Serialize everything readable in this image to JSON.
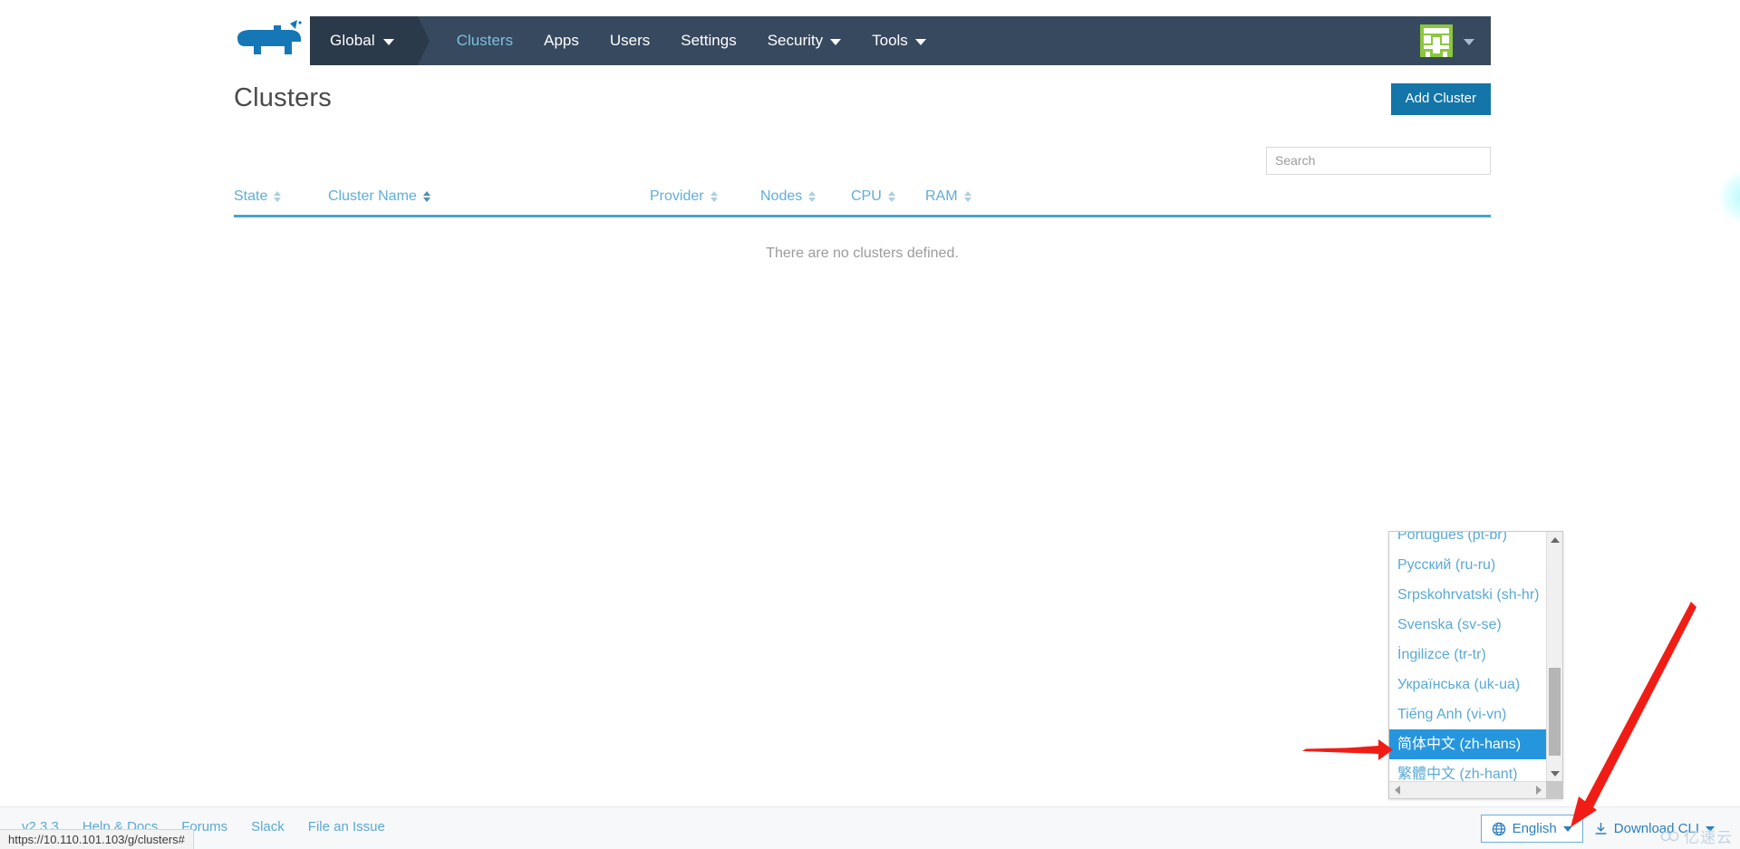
{
  "browser": {
    "status_url": "https://10.110.101.103/g/clusters#"
  },
  "header": {
    "logo_name": "rancher-cow-logo",
    "scope_selector": {
      "label": "Global"
    },
    "nav": [
      {
        "label": "Clusters",
        "active": true,
        "has_caret": false
      },
      {
        "label": "Apps",
        "active": false,
        "has_caret": false
      },
      {
        "label": "Users",
        "active": false,
        "has_caret": false
      },
      {
        "label": "Settings",
        "active": false,
        "has_caret": false
      },
      {
        "label": "Security",
        "active": false,
        "has_caret": true
      },
      {
        "label": "Tools",
        "active": false,
        "has_caret": true
      }
    ],
    "avatar_alt": "user-avatar"
  },
  "page": {
    "title": "Clusters",
    "add_button": "Add Cluster",
    "search_placeholder": "Search",
    "search_value": "",
    "empty_message": "There are no clusters defined."
  },
  "table": {
    "columns": [
      {
        "label": "State",
        "sorted": false
      },
      {
        "label": "Cluster Name",
        "sorted": true
      },
      {
        "label": "Provider",
        "sorted": false
      },
      {
        "label": "Nodes",
        "sorted": false
      },
      {
        "label": "CPU",
        "sorted": false
      },
      {
        "label": "RAM",
        "sorted": false
      }
    ]
  },
  "language_menu": {
    "open": true,
    "selected": "简体中文 (zh-hans)",
    "items": [
      {
        "label": "Português (pt-br)",
        "selected": false
      },
      {
        "label": "Русский (ru-ru)",
        "selected": false
      },
      {
        "label": "Srpskohrvatski (sh-hr)",
        "selected": false
      },
      {
        "label": "Svenska (sv-se)",
        "selected": false
      },
      {
        "label": "İngilizce (tr-tr)",
        "selected": false
      },
      {
        "label": "Українська (uk-ua)",
        "selected": false
      },
      {
        "label": "Tiếng Anh (vi-vn)",
        "selected": false
      },
      {
        "label": "简体中文 (zh-hans)",
        "selected": true
      },
      {
        "label": "繁體中文 (zh-hant)",
        "selected": false
      }
    ]
  },
  "footer": {
    "links": [
      {
        "label": "v2.3.3"
      },
      {
        "label": "Help & Docs"
      },
      {
        "label": "Forums"
      },
      {
        "label": "Slack"
      },
      {
        "label": "File an Issue"
      }
    ],
    "language_button": "English",
    "download_button": "Download CLI",
    "watermark": "亿速云"
  },
  "colors": {
    "nav_bg": "#37495e",
    "nav_scope_bg": "#2b3a4a",
    "accent_blue": "#1475a8",
    "link_blue": "#5aa9d6",
    "table_rule": "#4aa3cc",
    "selected_bg": "#2596de",
    "avatar_green": "#8cc63e",
    "annotation_red": "#f01d16"
  }
}
